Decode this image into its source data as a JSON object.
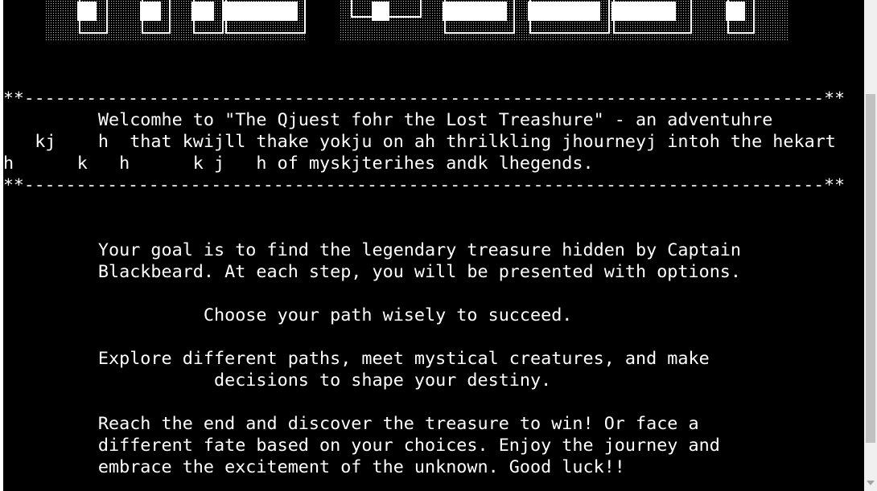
{
  "terminal": {
    "separator": "**-----------------------------------------------------------------------------**",
    "welcome_lines": [
      "         Welcomhe to \"The Qjuest fohr the Lost Treashure\" - an adventuhre",
      "   kj    h  that kwijll thake yokju on ah thrilkling jhourneyj intoh the hekart",
      "h      k   h      k j   h of myskjterihes andk lhegends."
    ],
    "intro_lines": [
      "         Your goal is to find the legendary treasure hidden by Captain",
      "         Blackbeard. At each step, you will be presented with options.",
      "",
      "                   Choose your path wisely to succeed.",
      "",
      "         Explore different paths, meet mystical creatures, and make",
      "                    decisions to shape your destiny.",
      "",
      "         Reach the end and discover the treasure to win! Or face a",
      "         different fate based on your choices. Enjoy the journey and",
      "         embrace the excitement of the unknown. Good luck!!"
    ]
  },
  "colors": {
    "background": "#000000",
    "text": "#ffffff",
    "scrollbar_track": "#f0f0f0",
    "scrollbar_thumb": "#c1c1c1"
  },
  "icons": {
    "banner": "ascii-art-title-banner",
    "scroll_down": "chevron-down-icon"
  }
}
